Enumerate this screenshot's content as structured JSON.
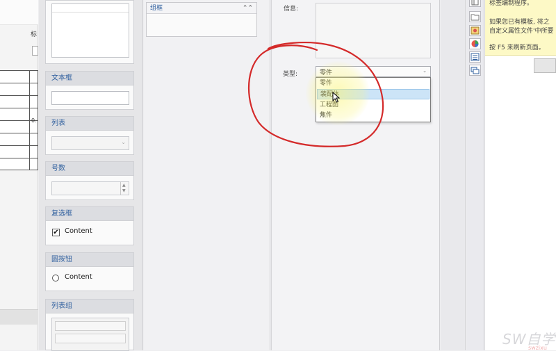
{
  "left_sheet": {
    "label": "标",
    "value": "0."
  },
  "palette": {
    "cards": [
      {
        "title": "文本框"
      },
      {
        "title": "列表"
      },
      {
        "title": "号数"
      },
      {
        "title": "复选框",
        "option_label": "Content",
        "checked": true
      },
      {
        "title": "圆按钮",
        "option_label": "Content"
      },
      {
        "title": "列表组"
      }
    ],
    "checkbox_mark": "✔"
  },
  "canvas": {
    "group_box": {
      "title": "组框"
    }
  },
  "properties": {
    "info_label": "信息:",
    "type_label": "类型:",
    "type_value": "零件",
    "type_options": [
      "零件",
      "装配体",
      "工程图",
      "焦件"
    ],
    "hovered_option_index": 1
  },
  "task_pane": {
    "tips": [
      "标签编制程序。",
      "如果您已有模板, 将之",
      "自定义属性文件'中所要",
      "按 F5 来刷新页面。"
    ]
  },
  "watermark": {
    "text": "SW自学",
    "url": "swzixu"
  },
  "colors": {
    "annotation": "#d42a2a",
    "highlight": "#faf578",
    "selection": "#cce4f7",
    "card_title": "#2f5f9e"
  }
}
